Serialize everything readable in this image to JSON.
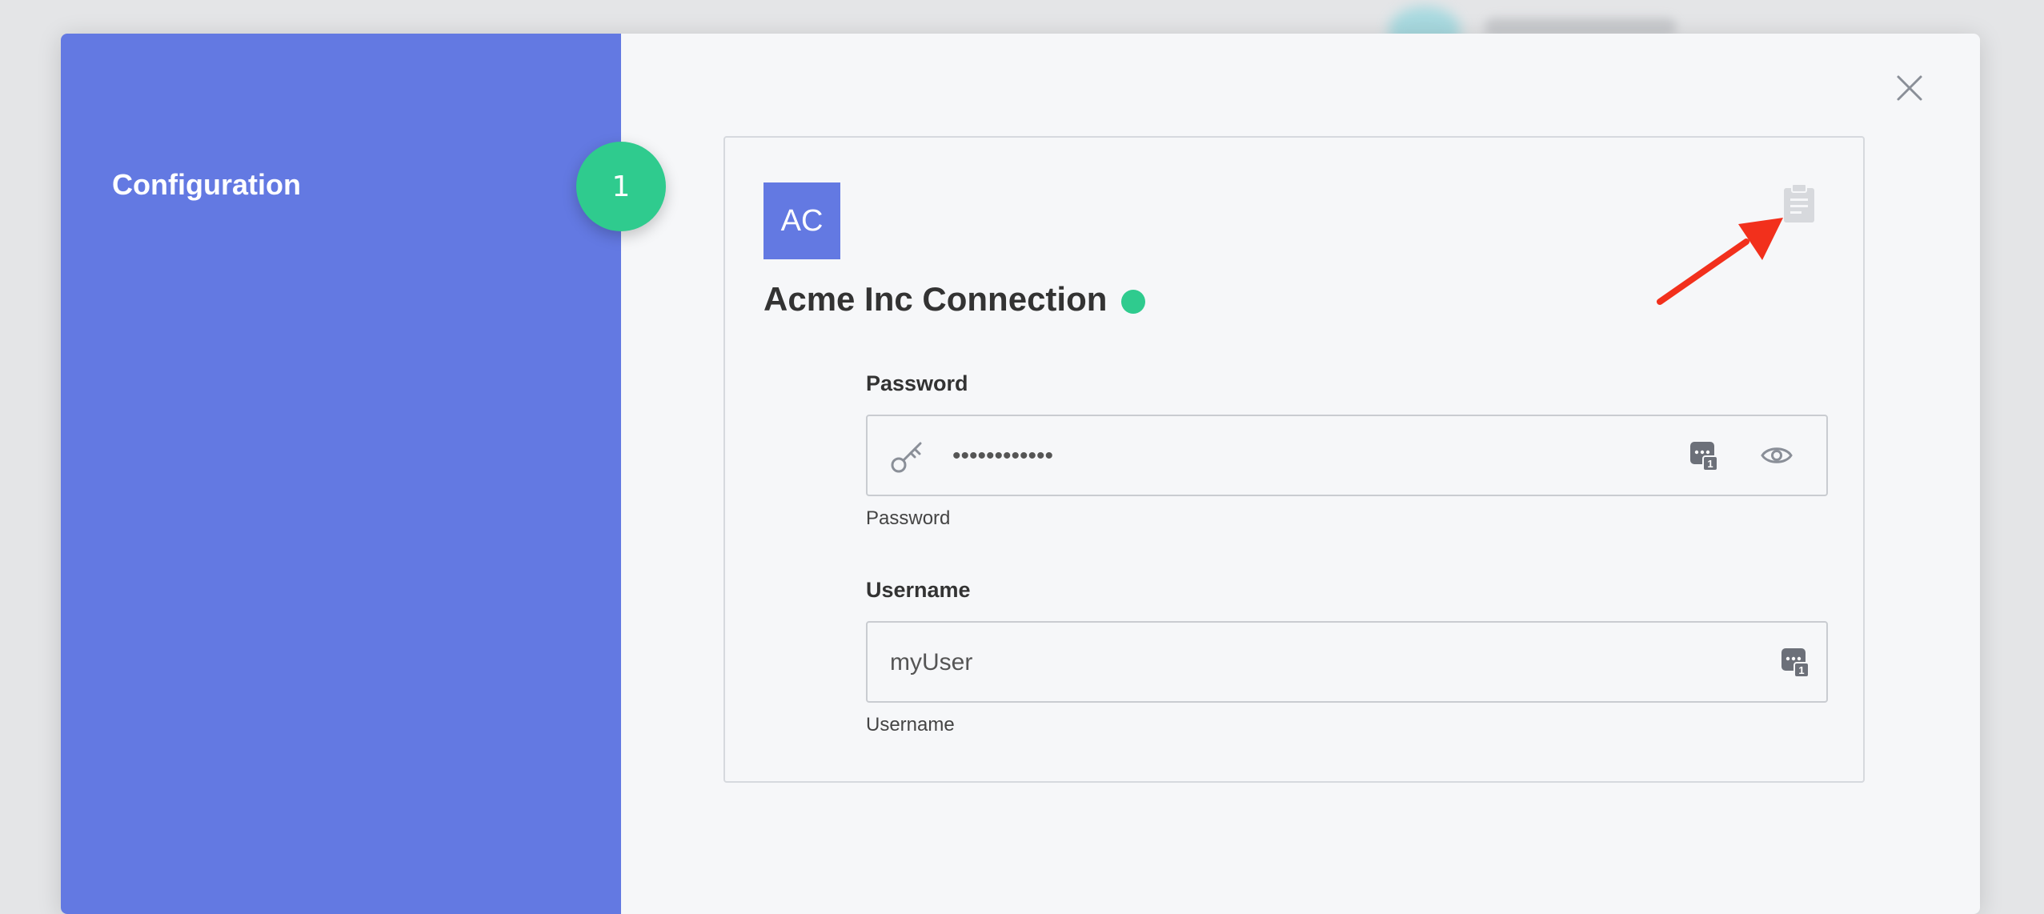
{
  "sidebar": {
    "title": "Configuration",
    "step_number": "1",
    "background_color": "#6379e2"
  },
  "close_icon": "close-icon",
  "connection": {
    "avatar_initials": "AC",
    "name": "Acme Inc Connection",
    "status_color": "#2fcb8e",
    "clipboard_icon": "clipboard-icon"
  },
  "fields": {
    "password": {
      "label": "Password",
      "value": "••••••••••••",
      "hint": "Password",
      "icons": [
        "key-icon",
        "password-manager-icon",
        "eye-icon"
      ]
    },
    "username": {
      "label": "Username",
      "value": "myUser",
      "hint": "Username",
      "icons": [
        "password-manager-icon"
      ]
    }
  },
  "annotation": {
    "arrow_color": "#f2301c"
  }
}
